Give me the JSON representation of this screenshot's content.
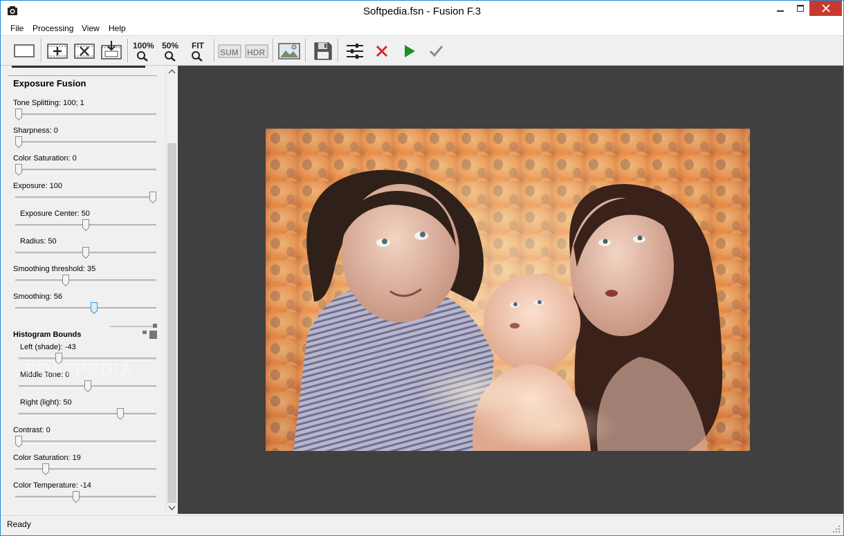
{
  "window": {
    "title": "Softpedia.fsn - Fusion F.3"
  },
  "menu": [
    "File",
    "Processing",
    "View",
    "Help"
  ],
  "toolbar": {
    "zoom100": "100%",
    "zoom50": "50%",
    "zoomfit": "FIT",
    "sum": "SUM",
    "hdr": "HDR"
  },
  "panel": {
    "title": "Exposure Fusion",
    "histogram_title": "Histogram Bounds",
    "sliders": [
      {
        "label": "Tone Splitting: 100; 1",
        "value": 0.0
      },
      {
        "label": "Sharpness: 0",
        "value": 0.0
      },
      {
        "label": "Color Saturation: 0",
        "value": 0.0
      },
      {
        "label": "Exposure: 100",
        "value": 1.0
      },
      {
        "label": "Exposure Center: 50",
        "value": 0.5
      },
      {
        "label": "Radius: 50",
        "value": 0.5
      },
      {
        "label": "Smoothing threshold: 35",
        "value": 0.35
      },
      {
        "label": "Smoothing: 56",
        "value": 0.56
      },
      {
        "label": "Left (shade): -43",
        "value": 0.28
      },
      {
        "label": "Middle Tone: 0",
        "value": 0.5
      },
      {
        "label": "Right (light): 50",
        "value": 0.75
      },
      {
        "label": "Contrast: 0",
        "value": 0.0
      },
      {
        "label": "Color Saturation: 19",
        "value": 0.2
      },
      {
        "label": "Color Temperature: -14",
        "value": 0.43
      }
    ]
  },
  "watermark": "SOFTPEDIA",
  "status": "Ready",
  "colors": {
    "accent": "#1e8ad6",
    "close": "#c7392f",
    "canvas": "#404040"
  }
}
